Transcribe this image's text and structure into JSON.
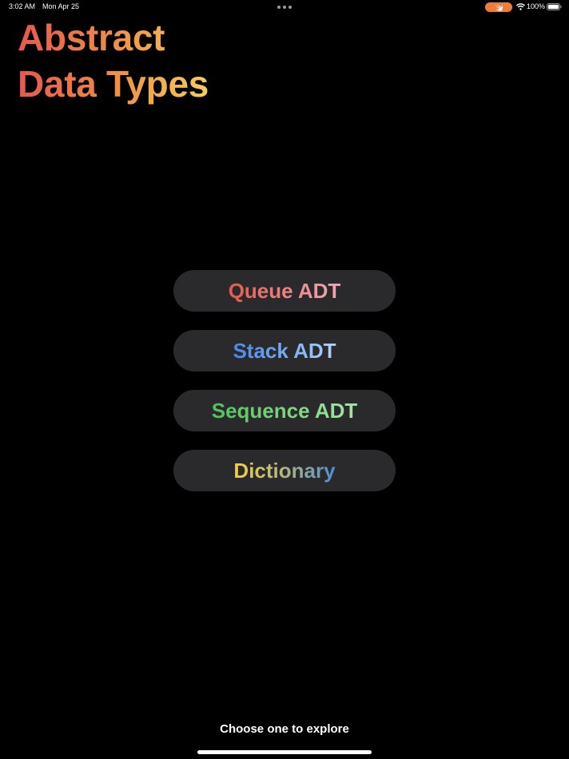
{
  "status_bar": {
    "time": "3:02 AM",
    "date": "Mon Apr 25",
    "battery": "100%",
    "accent_color": "#ef7d3a"
  },
  "title": {
    "line1": "Abstract",
    "line2": "Data Types"
  },
  "menu": {
    "items": [
      {
        "label": "Queue ADT"
      },
      {
        "label": "Stack ADT"
      },
      {
        "label": "Sequence ADT"
      },
      {
        "label": "Dictionary"
      }
    ]
  },
  "footer": {
    "hint": "Choose one to explore"
  },
  "colors": {
    "background": "#000000",
    "button_background": "#2a2a2c",
    "title_gradient": [
      "#e8574f",
      "#f8d35a"
    ],
    "queue_gradient": [
      "#e25a50",
      "#f3a8b2"
    ],
    "stack_gradient": [
      "#4a86e8",
      "#b3d3f7"
    ],
    "sequence_gradient": [
      "#4fc25a",
      "#a6e6a3"
    ],
    "dictionary_gradient": [
      "#f2cf44",
      "#4f8ed8"
    ]
  },
  "icons": {
    "multitask": "multitask-dots-icon",
    "swift": "swift-icon",
    "wifi": "wifi-icon",
    "battery": "battery-icon"
  }
}
